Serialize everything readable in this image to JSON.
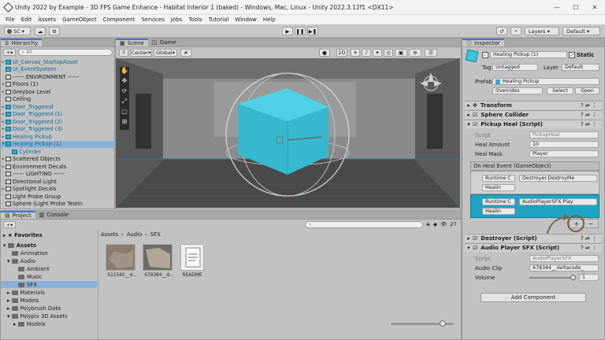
{
  "window": {
    "title": "Unity 2022 by Example - 3D FPS Game Enhance - Habitat Interior 1 (baked) - Windows, Mac, Linux - Unity 2022.3.12f1 <DX11>",
    "min": "—",
    "max": "☐",
    "close": "✕"
  },
  "menu": [
    "File",
    "Edit",
    "Assets",
    "GameObject",
    "Component",
    "Services",
    "Jobs",
    "Tools",
    "Tutorial",
    "Window",
    "Help"
  ],
  "toolbar": {
    "account": "SC",
    "play": "▶",
    "pause": "❚❚",
    "step": "▶❚",
    "layers": "Layers",
    "layout": "Default"
  },
  "hierarchy": {
    "tab": "Hierarchy",
    "search_placeholder": "All",
    "items": [
      {
        "label": "UI_Canvas_StartupAsset",
        "style": "prefab"
      },
      {
        "label": "UI_EventSystem",
        "style": "prefab"
      },
      {
        "label": "------ ENVIRONMENT ------",
        "style": "normal"
      },
      {
        "label": "Floors (1)",
        "style": "normal"
      },
      {
        "label": "Greybox Level",
        "style": "normal"
      },
      {
        "label": "Ceiling",
        "style": "normal"
      },
      {
        "label": "Door_Triggered",
        "style": "prefab"
      },
      {
        "label": "Door_Triggered (1)",
        "style": "prefab"
      },
      {
        "label": "Door_Triggered (2)",
        "style": "prefab"
      },
      {
        "label": "Door_Triggered (3)",
        "style": "prefab"
      },
      {
        "label": "Healing Pickup",
        "style": "prefab"
      },
      {
        "label": "Healing Pickup (1)",
        "style": "selected"
      },
      {
        "label": "Cylinder",
        "style": "prefab"
      },
      {
        "label": "Scattered Objects",
        "style": "normal"
      },
      {
        "label": "Environment Decals",
        "style": "normal"
      },
      {
        "label": "------ LIGHTING ------",
        "style": "normal"
      },
      {
        "label": "Directional Light",
        "style": "normal"
      },
      {
        "label": "Spotlight Decals",
        "style": "normal"
      },
      {
        "label": "Light Probe Group",
        "style": "normal"
      },
      {
        "label": "Sphere (Light Probe Testin",
        "style": "normal"
      }
    ]
  },
  "scene": {
    "tabs": [
      "Scene",
      "Game"
    ],
    "pivot": "Center",
    "space": "Global",
    "mode_2d": "2D",
    "persp": "Persp"
  },
  "project": {
    "tabs": [
      "Project",
      "Console"
    ],
    "breadcrumb": [
      "Assets",
      "Audio",
      "SFX"
    ],
    "count": "27",
    "tree": [
      {
        "label": "Favorites",
        "level": 0,
        "bold": true
      },
      {
        "label": "Assets",
        "level": 0,
        "bold": true
      },
      {
        "label": "Animation",
        "level": 1
      },
      {
        "label": "Audio",
        "level": 1
      },
      {
        "label": "Ambient",
        "level": 2
      },
      {
        "label": "Music",
        "level": 2
      },
      {
        "label": "SFX",
        "level": 2,
        "selected": true
      },
      {
        "label": "Materials",
        "level": 1
      },
      {
        "label": "Models",
        "level": 1
      },
      {
        "label": "Polybrush Data",
        "level": 1
      },
      {
        "label": "Polypix 3D Assets",
        "level": 1
      },
      {
        "label": "Models",
        "level": 2
      }
    ],
    "assets": [
      {
        "label": "511540__d..."
      },
      {
        "label": "678384__d..."
      },
      {
        "label": "README"
      }
    ]
  },
  "inspector": {
    "tab": "Inspector",
    "object_name": "Healing Pickup (1)",
    "static": "Static",
    "tag_label": "Tag",
    "tag_value": "Untagged",
    "layer_label": "Layer",
    "layer_value": "Default",
    "prefab_label": "Prefab",
    "prefab_value": "Healing Pickup",
    "overrides": "Overrides",
    "select": "Select",
    "open": "Open",
    "components": {
      "transform": "Transform",
      "sphere_collider": "Sphere Collider",
      "pickup_heal": "Pickup Heal (Script)",
      "destroyer": "Destroyer (Script)",
      "audio_sfx": "Audio Player SFX (Script)"
    },
    "pickup": {
      "script_label": "Script",
      "script_value": "PickupHeal",
      "heal_amount_label": "Heal Amount",
      "heal_amount": "10",
      "heal_mask_label": "Heal Mask",
      "heal_mask": "Player",
      "event_header": "On Heal Event (GameObject)",
      "entries": [
        {
          "runtime": "Runtime C",
          "method": "Destroyer.DestroyMe",
          "object": "Healin"
        },
        {
          "runtime": "Runtime C",
          "method": "AudioPlayerSFX.Play",
          "object": "Healin"
        }
      ],
      "plus": "+",
      "minus": "−"
    },
    "audio": {
      "script_label": "Script",
      "script_value": "AudioPlayerSFX",
      "clip_label": "Audio Clip",
      "clip_value": "678384__deltacode_",
      "volume_label": "Volume",
      "volume": "1",
      "volume_fraction": 1.0
    },
    "add_component": "Add Component"
  },
  "colors": {
    "accent": "#3a79d8",
    "selection_teal": "#1ea4c2",
    "prefab_blue": "#0c6a94",
    "cube": "#3bc3dc"
  }
}
